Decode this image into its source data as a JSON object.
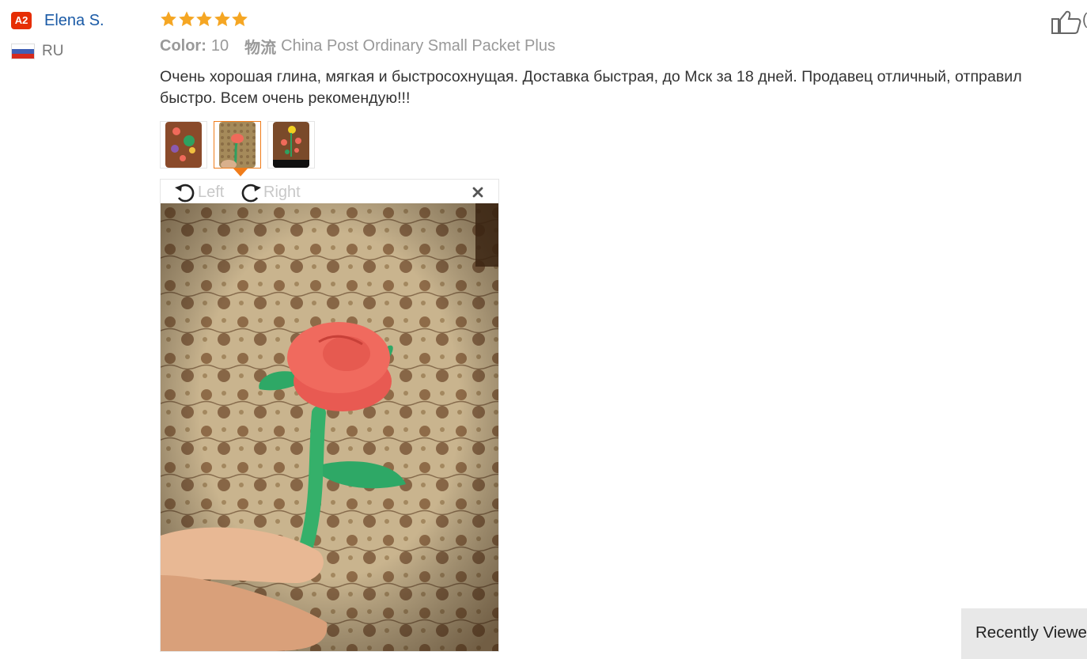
{
  "user": {
    "level_badge": "A2",
    "name": "Elena S.",
    "country_code": "RU",
    "flag_icon": "russia-flag-icon"
  },
  "review": {
    "stars_filled": 5,
    "stars_total": 5,
    "star_color": "#f5a623",
    "color_label": "Color:",
    "color_value": "10",
    "logistics_label": "物流",
    "logistics_value": "China Post Ordinary Small Packet Plus",
    "text": "Очень хорошая глина, мягкая и быстросохнущая. Доставка быстрая, до Мск за 18 дней. Продавец отличный, отправил быстро. Всем очень рекомендую!!!"
  },
  "thumbnails": [
    {
      "name": "thumbnail-1",
      "selected": false
    },
    {
      "name": "thumbnail-2",
      "selected": true
    },
    {
      "name": "thumbnail-3",
      "selected": false
    }
  ],
  "viewer": {
    "rotate_left_label": "Left",
    "rotate_right_label": "Right",
    "close_icon": "close-icon"
  },
  "like": {
    "icon": "thumbs-up-icon",
    "count_prefix": "("
  },
  "recently_viewed": {
    "label": "Recently Viewed"
  },
  "colors": {
    "accent_orange": "#f07c1a",
    "badge_red": "#e62e04",
    "link_blue": "#1a5aa6"
  }
}
